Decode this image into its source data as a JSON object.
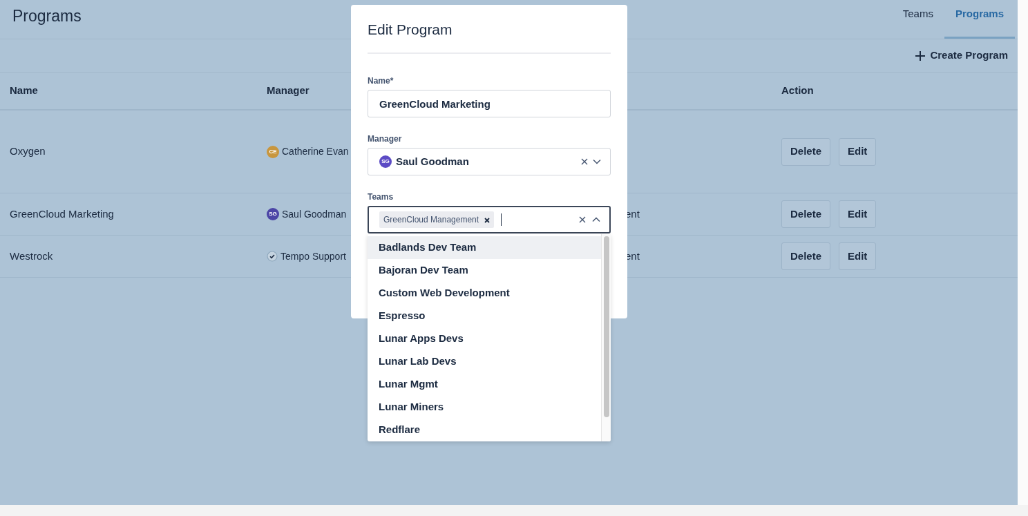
{
  "header": {
    "title": "Programs",
    "tabs": [
      {
        "label": "Teams",
        "selected": false
      },
      {
        "label": "Programs",
        "selected": true
      }
    ]
  },
  "toolbar": {
    "create_button": "Create Program"
  },
  "table": {
    "columns": [
      "Name",
      "Manager",
      "Action"
    ],
    "rows": [
      {
        "name": "Oxygen",
        "manager": {
          "kind": "avatar",
          "initials": "CE",
          "color": "#c8963e",
          "name": "Catherine Evan"
        },
        "action_buttons": [
          "Delete",
          "Edit"
        ]
      },
      {
        "name": "GreenCloud Marketing",
        "manager": {
          "kind": "avatar",
          "initials": "SG",
          "color": "#4b45a6",
          "name": "Saul Goodman"
        },
        "column_3": "ent",
        "action_buttons": [
          "Delete",
          "Edit"
        ]
      },
      {
        "name": "Westrock",
        "manager": {
          "kind": "check",
          "name": "Tempo Support"
        },
        "column_3": "ent",
        "action_buttons": [
          "Delete",
          "Edit"
        ]
      }
    ]
  },
  "modal": {
    "title": "Edit Program",
    "name_field": {
      "label": "Name*",
      "value": "GreenCloud Marketing"
    },
    "manager_field": {
      "label": "Manager",
      "initials": "SG",
      "color": "#5c4bc5",
      "value": "Saul Goodman"
    },
    "teams_field": {
      "label": "Teams",
      "expanded": true,
      "chips": [
        "GreenCloud Management"
      ],
      "options": [
        {
          "label": "Badlands Dev Team",
          "focused": true
        },
        {
          "label": "Bajoran Dev Team",
          "focused": false
        },
        {
          "label": "Custom Web Development",
          "focused": false
        },
        {
          "label": "Espresso",
          "focused": false
        },
        {
          "label": "Lunar Apps Devs",
          "focused": false
        },
        {
          "label": "Lunar Lab Devs",
          "focused": false
        },
        {
          "label": "Lunar Mgmt",
          "focused": false
        },
        {
          "label": "Lunar Miners",
          "focused": false
        },
        {
          "label": "Redflare",
          "focused": false
        }
      ]
    }
  }
}
